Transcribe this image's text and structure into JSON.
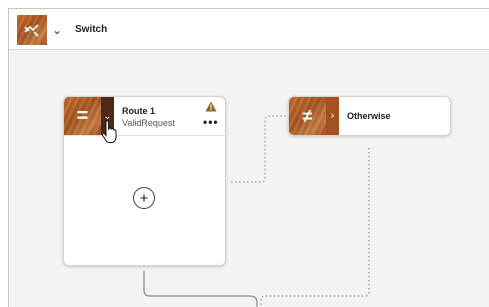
{
  "header": {
    "title": "Switch",
    "icon": "switch-icon"
  },
  "route": {
    "title": "Route 1",
    "condition": "ValidRequest",
    "icon": "equals-icon",
    "warning_icon": "warning-icon",
    "more_icon": "more-icon",
    "more_label": "•••",
    "add_label": "+"
  },
  "otherwise": {
    "title": "Otherwise",
    "icon": "not-equal-icon"
  },
  "colors": {
    "accent": "#b35d26",
    "accent_dark": "#4b2a1a",
    "warning": "#8a6420"
  }
}
